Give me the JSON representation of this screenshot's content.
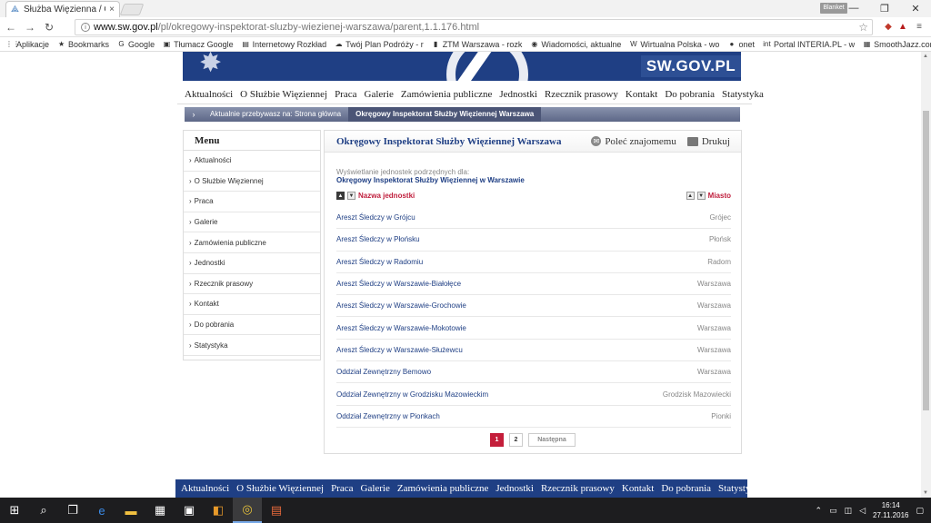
{
  "browser": {
    "tab_title": "Służba Więzienna / Okrę",
    "tab_close": "×",
    "user_label": "Blanket",
    "window_buttons": [
      "—",
      "❐",
      "✕"
    ],
    "url_host": "www.sw.gov.pl",
    "url_path": "/pl/okregowy-inspektorat-sluzby-wiezienej-warszawa/parent,1.1.176.html",
    "bookmarks": [
      {
        "icon": "apps-icon",
        "glyph": "⋮⋮",
        "label": "Aplikacje"
      },
      {
        "icon": "star-icon",
        "glyph": "★",
        "label": "Bookmarks"
      },
      {
        "icon": "google-icon",
        "glyph": "G",
        "label": "Google"
      },
      {
        "icon": "translate-icon",
        "glyph": "▣",
        "label": "Tłumacz Google"
      },
      {
        "icon": "page-icon",
        "glyph": "▤",
        "label": "Internetowy Rozkład"
      },
      {
        "icon": "cloud-icon",
        "glyph": "☁",
        "label": "Twój Plan Podróży - r"
      },
      {
        "icon": "ztm-icon",
        "glyph": "▮",
        "label": "ZTM Warszawa - rozk"
      },
      {
        "icon": "globe-icon",
        "glyph": "◉",
        "label": "Wiadomości, aktualne"
      },
      {
        "icon": "wp-icon",
        "glyph": "W",
        "label": "Wirtualna Polska - wo"
      },
      {
        "icon": "onet-icon",
        "glyph": "●",
        "label": "onet"
      },
      {
        "icon": "interia-icon",
        "glyph": "int",
        "label": "Portal INTERIA.PL - w"
      },
      {
        "icon": "music-icon",
        "glyph": "▦",
        "label": "SmoothJazz.com : The"
      }
    ]
  },
  "site": {
    "banner_text": "SW.GOV.PL",
    "nav": [
      "Aktualności",
      "O Służbie Więziennej",
      "Praca",
      "Galerie",
      "Zamówienia publiczne",
      "Jednostki",
      "Rzecznik prasowy",
      "Kontakt",
      "Do pobrania",
      "Statystyka"
    ],
    "breadcrumb": {
      "arrow": "›",
      "prefix": "Aktualnie przebywasz na:",
      "home": "Strona główna",
      "current": "Okręgowy Inspektorat Służby Więziennej Warszawa"
    },
    "sidebar": {
      "title": "Menu",
      "items": [
        "Aktualności",
        "O Służbie Więziennej",
        "Praca",
        "Galerie",
        "Zamówienia publiczne",
        "Jednostki",
        "Rzecznik prasowy",
        "Kontakt",
        "Do pobrania",
        "Statystyka"
      ]
    },
    "content": {
      "title": "Okręgowy Inspektorat Służby Więziennej Warszawa",
      "recommend_label": "Poleć znajomemu",
      "print_label": "Drukuj",
      "lead": "Wyświetlanie jednostek podrzędnych dla:",
      "unit_name": "Okręgowy Inspektorat Służby Więziennej w Warszawie",
      "col_name": "Nazwa jednostki",
      "col_city": "Miasto",
      "rows": [
        {
          "name": "Areszt Śledczy w Grójcu",
          "city": "Grójec"
        },
        {
          "name": "Areszt Śledczy w Płońsku",
          "city": "Płońsk"
        },
        {
          "name": "Areszt Śledczy w Radomiu",
          "city": "Radom"
        },
        {
          "name": "Areszt Śledczy w Warszawie-Białołęce",
          "city": "Warszawa"
        },
        {
          "name": "Areszt Śledczy w Warszawie-Grochowie",
          "city": "Warszawa"
        },
        {
          "name": "Areszt Śledczy w Warszawie-Mokotowie",
          "city": "Warszawa"
        },
        {
          "name": "Areszt Śledczy w Warszawie-Służewcu",
          "city": "Warszawa"
        },
        {
          "name": "Oddział Zewnętrzny Bemowo",
          "city": "Warszawa"
        },
        {
          "name": "Oddział Zewnętrzny w Grodzisku Mazowieckim",
          "city": "Grodzisk Mazowiecki"
        },
        {
          "name": "Oddział Zewnętrzny w Pionkach",
          "city": "Pionki"
        }
      ],
      "pages": [
        "1",
        "2"
      ],
      "next_label": "Następna"
    }
  },
  "taskbar": {
    "time": "16:14",
    "date": "27.11.2016"
  },
  "colors": {
    "brand_navy": "#1f3f84",
    "accent_red": "#c41e3a"
  }
}
